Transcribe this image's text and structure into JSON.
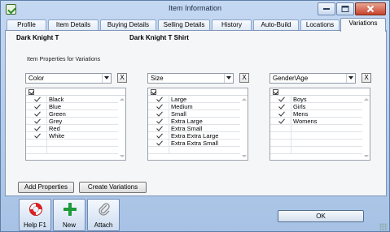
{
  "window": {
    "title": "Item Information"
  },
  "tabs": [
    "Profile",
    "Item Details",
    "Buying Details",
    "Selling Details",
    "History",
    "Auto-Build",
    "Locations",
    "Variations"
  ],
  "active_tab": "Variations",
  "item": {
    "code": "Dark Knight T",
    "name": "Dark Knight T Shirt"
  },
  "section_label": "Item Properties for Variations",
  "properties": [
    {
      "name": "Color",
      "values": [
        "Black",
        "Blue",
        "Green",
        "Grey",
        "Red",
        "White"
      ]
    },
    {
      "name": "Size",
      "values": [
        "Large",
        "Medium",
        "Small",
        "Extra Large",
        "Extra Small",
        "Extra Extra Large",
        "Extra Extra Small"
      ]
    },
    {
      "name": "Gender\\Age",
      "values": [
        "Boys",
        "Girls",
        "Mens",
        "Womens"
      ]
    }
  ],
  "remove_label": "X",
  "buttons": {
    "add_properties": "Add Properties",
    "create_variations": "Create Variations",
    "ok": "OK"
  },
  "toolbar": {
    "help": "Help F1",
    "new": "New",
    "attach": "Attach"
  }
}
